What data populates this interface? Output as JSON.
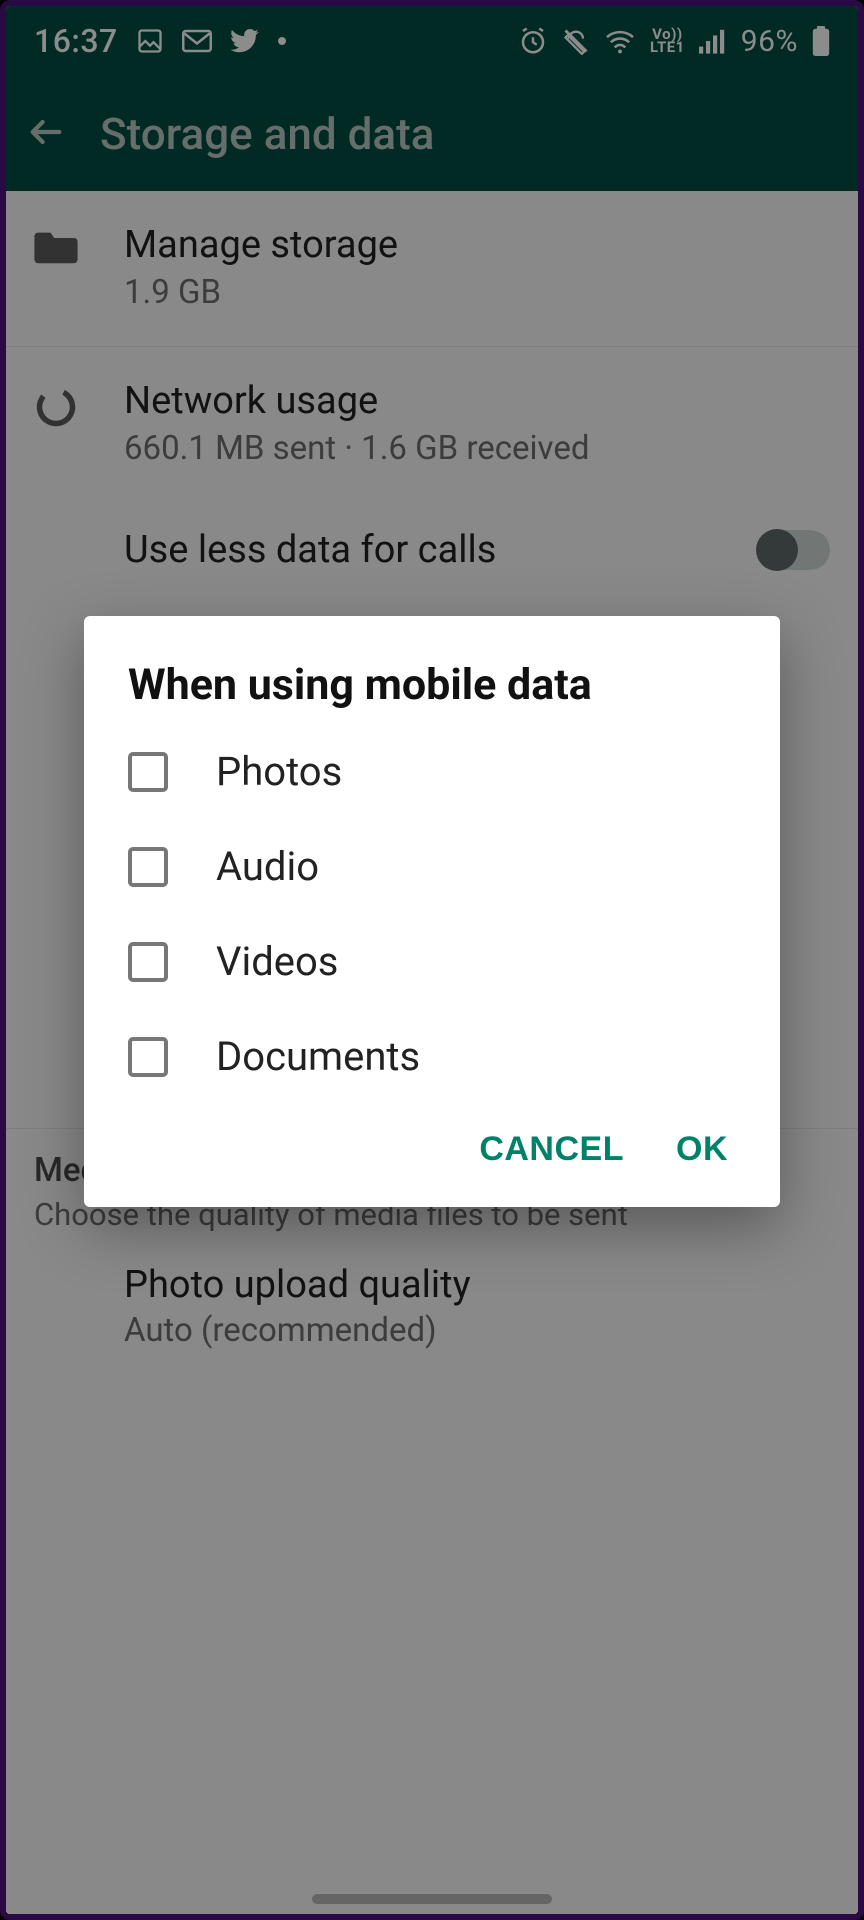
{
  "statusbar": {
    "time": "16:37",
    "battery_pct": "96%"
  },
  "appbar": {
    "title": "Storage and data"
  },
  "rows": {
    "manage_storage": {
      "title": "Manage storage",
      "sub": "1.9 GB"
    },
    "network_usage": {
      "title": "Network usage",
      "sub": "660.1 MB sent · 1.6 GB received"
    },
    "use_less_data": {
      "label": "Use less data for calls"
    }
  },
  "section_media": {
    "header": "Media upload quality",
    "sub": "Choose the quality of media files to be sent"
  },
  "photo_quality": {
    "title": "Photo upload quality",
    "sub": "Auto (recommended)"
  },
  "dialog": {
    "title": "When using mobile data",
    "options": {
      "photos": "Photos",
      "audio": "Audio",
      "videos": "Videos",
      "documents": "Documents"
    },
    "cancel": "CANCEL",
    "ok": "OK"
  }
}
